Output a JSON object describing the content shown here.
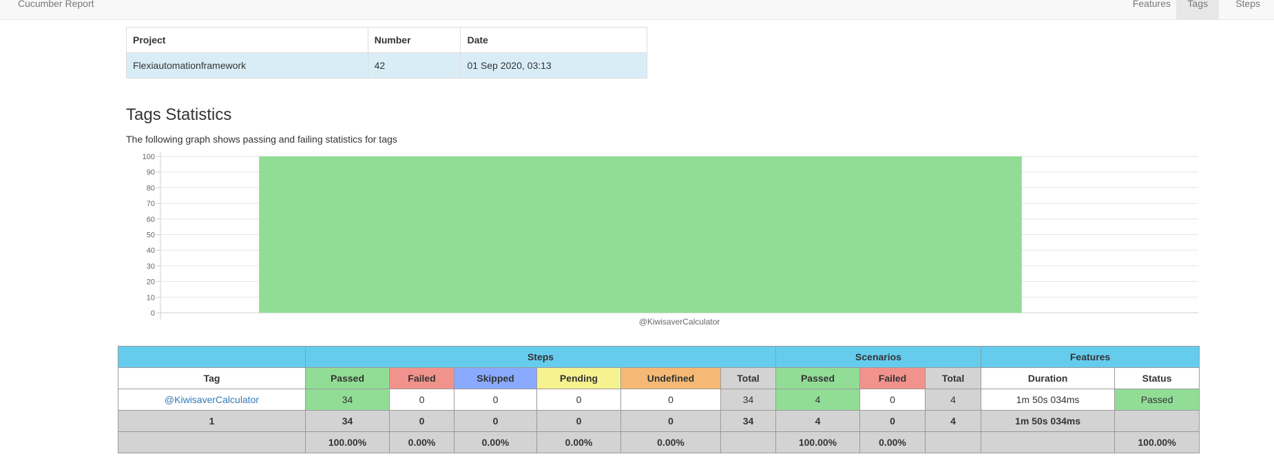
{
  "navbar": {
    "brand": "Cucumber Report",
    "links": [
      "Features",
      "Tags",
      "Steps"
    ],
    "active": "Tags"
  },
  "info_table": {
    "headers": [
      "Project",
      "Number",
      "Date"
    ],
    "row": [
      "Flexiautomationframework",
      "42",
      "01 Sep 2020, 03:13"
    ]
  },
  "section": {
    "title": "Tags Statistics",
    "subtitle": "The following graph shows passing and failing statistics for tags"
  },
  "chart_data": {
    "type": "bar",
    "stacked": true,
    "categories": [
      "@KiwisaverCalculator"
    ],
    "series": [
      {
        "values": [
          100
        ],
        "color": "#92dd96"
      }
    ],
    "yticks": [
      0,
      10,
      20,
      30,
      40,
      50,
      60,
      70,
      80,
      90,
      100
    ],
    "ylim": [
      0,
      100
    ],
    "grid": true
  },
  "stats": {
    "group_headers": {
      "steps": "Steps",
      "scenarios": "Scenarios",
      "features": "Features"
    },
    "columns": [
      "Tag",
      "Passed",
      "Failed",
      "Skipped",
      "Pending",
      "Undefined",
      "Total",
      "Passed",
      "Failed",
      "Total",
      "Duration",
      "Status"
    ],
    "row": {
      "tag": "@KiwisaverCalculator",
      "steps_passed": "34",
      "steps_failed": "0",
      "steps_skipped": "0",
      "steps_pending": "0",
      "steps_undefined": "0",
      "steps_total": "34",
      "scen_passed": "4",
      "scen_failed": "0",
      "scen_total": "4",
      "duration": "1m 50s 034ms",
      "status": "Passed"
    },
    "totals": {
      "count": "1",
      "steps_passed": "34",
      "steps_failed": "0",
      "steps_skipped": "0",
      "steps_pending": "0",
      "steps_undefined": "0",
      "steps_total": "34",
      "scen_passed": "4",
      "scen_failed": "0",
      "scen_total": "4",
      "duration": "1m 50s 034ms"
    },
    "percent": {
      "steps_passed": "100.00%",
      "steps_failed": "0.00%",
      "steps_skipped": "0.00%",
      "steps_pending": "0.00%",
      "steps_undefined": "0.00%",
      "scen_passed": "100.00%",
      "scen_failed": "0.00%",
      "status": "100.00%"
    }
  },
  "colors": {
    "header_blue": "#66ccee",
    "passed": "#92dd96",
    "failed": "#f2928c",
    "skipped": "#8aaaff",
    "pending": "#f5f28f",
    "undefined": "#f5b975",
    "total": "#d3d3d3",
    "link": "#337ab7"
  }
}
